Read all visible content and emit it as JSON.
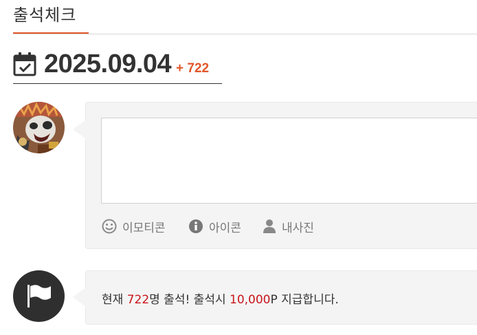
{
  "header": {
    "title": "출석체크"
  },
  "attendance": {
    "date": "2025.09.04",
    "count_badge": "+ 722"
  },
  "comment": {
    "textarea_value": "",
    "tools": [
      {
        "label": "이모티콘",
        "icon": "smile-icon"
      },
      {
        "label": "아이콘",
        "icon": "info-icon"
      },
      {
        "label": "내사진",
        "icon": "user-icon"
      }
    ]
  },
  "notice": {
    "prefix": "현재 ",
    "count": "722",
    "mid": "명 출석! 출석시 ",
    "points": "10,000",
    "suffix": "P 지급합니다."
  },
  "colors": {
    "accent": "#e2562a",
    "highlight": "#c8151b",
    "panel": "#f4f4f4"
  }
}
